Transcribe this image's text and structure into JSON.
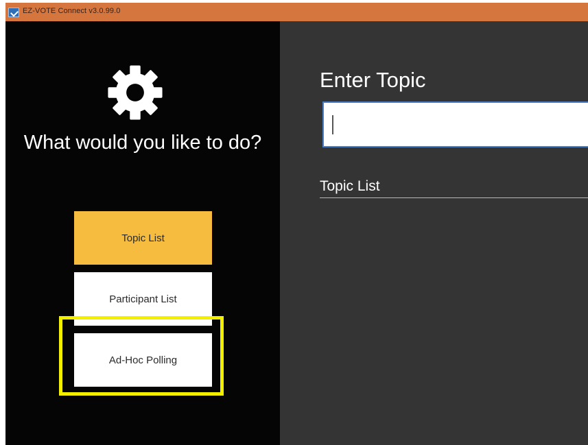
{
  "window": {
    "title": "EZ-VOTE Connect v3.0.99.0",
    "titlebar_color": "#d5763f"
  },
  "sidebar": {
    "icon": "gear-icon",
    "prompt": "What would you like to do?",
    "buttons": [
      {
        "label": "Topic List",
        "selected": true,
        "color": "#f5bc3f"
      },
      {
        "label": "Participant List",
        "selected": false,
        "color": "#ffffff"
      },
      {
        "label": "Ad-Hoc Polling",
        "selected": false,
        "color": "#ffffff",
        "highlighted": true
      }
    ],
    "highlight_color": "#f2f000"
  },
  "main": {
    "heading": "Enter Topic",
    "topic_input": {
      "value": "",
      "placeholder": ""
    },
    "list_label": "Topic List"
  }
}
